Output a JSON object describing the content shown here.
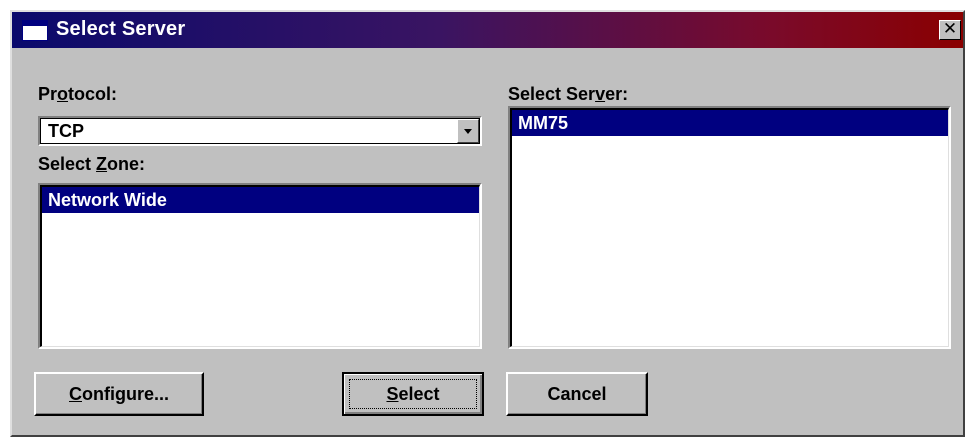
{
  "window": {
    "title": "Select Server",
    "close_glyph": "✕"
  },
  "protocol": {
    "label_pre": "Pr",
    "label_key": "o",
    "label_post": "tocol:",
    "value": "TCP",
    "arrow_icon": "chevron-down-icon"
  },
  "zone": {
    "label_pre": "Select ",
    "label_key": "Z",
    "label_post": "one:",
    "items": [
      "Network Wide"
    ],
    "selected_index": 0
  },
  "server": {
    "label_pre": "Select Ser",
    "label_key": "v",
    "label_post": "er:",
    "items": [
      "MM75"
    ],
    "selected_index": 0
  },
  "buttons": {
    "configure": {
      "key": "C",
      "rest": "onfigure..."
    },
    "select": {
      "key": "S",
      "rest": "elect"
    },
    "cancel": {
      "label": "Cancel"
    }
  },
  "colors": {
    "face": "#c0c0c0",
    "selection": "#000080",
    "title_start": "#0a0a6c",
    "title_end": "#8a0000"
  }
}
